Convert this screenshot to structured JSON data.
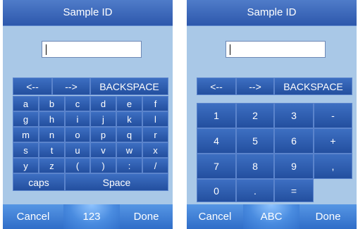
{
  "left_panel": {
    "title": "Sample ID",
    "field_value": "",
    "nav_keys": [
      "<--",
      "-->",
      "BACKSPACE"
    ],
    "letter_rows": [
      [
        "a",
        "b",
        "c",
        "d",
        "e",
        "f"
      ],
      [
        "g",
        "h",
        "i",
        "j",
        "k",
        "l"
      ],
      [
        "m",
        "n",
        "o",
        "p",
        "q",
        "r"
      ],
      [
        "s",
        "t",
        "u",
        "v",
        "w",
        "x"
      ],
      [
        "y",
        "z",
        "(",
        ")",
        ":",
        "/"
      ]
    ],
    "caps_label": "caps",
    "space_label": "Space",
    "cancel_label": "Cancel",
    "mode_label": "123",
    "done_label": "Done"
  },
  "right_panel": {
    "title": "Sample ID",
    "field_value": "",
    "nav_keys": [
      "<--",
      "-->",
      "BACKSPACE"
    ],
    "number_rows": [
      [
        "1",
        "2",
        "3",
        "-"
      ],
      [
        "4",
        "5",
        "6",
        "+"
      ],
      [
        "7",
        "8",
        "9",
        ","
      ],
      [
        "0",
        ".",
        "="
      ]
    ],
    "cancel_label": "Cancel",
    "mode_label": "ABC",
    "done_label": "Done"
  },
  "colors": {
    "panel_bg": "#a9c8e7",
    "key_bg": "#2f5fb3",
    "bar_bg": "#4682d6"
  }
}
